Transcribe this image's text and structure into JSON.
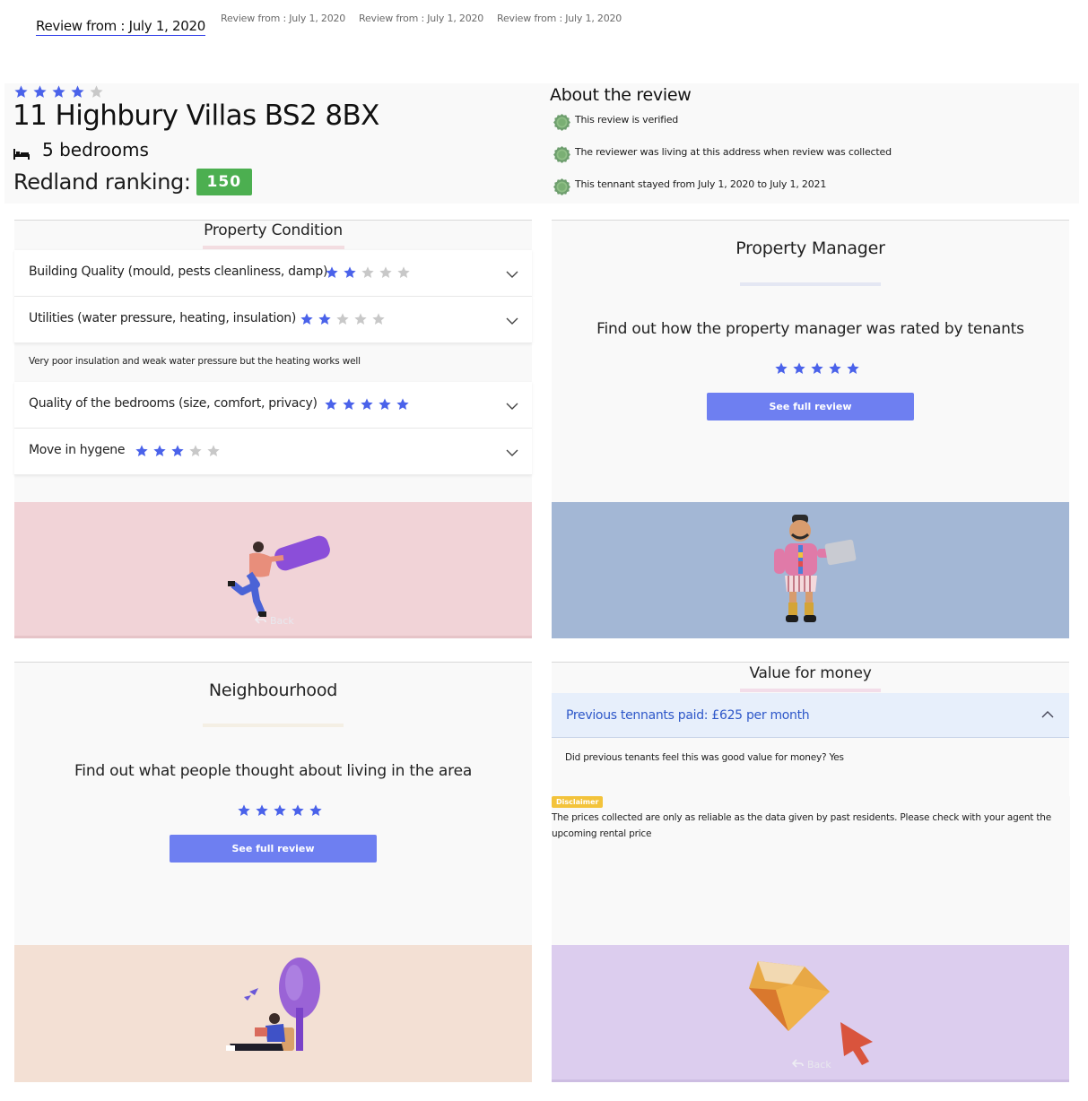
{
  "tabs": [
    {
      "label": "Review from : July 1, 2020",
      "active": true
    },
    {
      "label": "Review from : July 1, 2020",
      "active": false
    },
    {
      "label": "Review from : July 1, 2020",
      "active": false
    },
    {
      "label": "Review from : July 1, 2020",
      "active": false
    }
  ],
  "header": {
    "rating": 4,
    "rating_max": 5,
    "address": "11 Highbury Villas BS2 8BX",
    "bedrooms": "5 bedrooms",
    "ranking_label": "Redland ranking:",
    "ranking_value": "150"
  },
  "about": {
    "title": "About the review",
    "items": [
      "This review is verified",
      "The reviewer was living at this address when review was collected",
      "This tennant stayed from July 1, 2020 to July 1, 2021"
    ]
  },
  "property_condition": {
    "title": "Property Condition",
    "rows": [
      {
        "label": "Building Quality (mould, pests cleanliness, damp)",
        "rating": 2
      },
      {
        "label": "Utilities (water pressure, heating, insulation)",
        "rating": 2
      },
      {
        "label": "Quality of the bedrooms (size, comfort, privacy)",
        "rating": 5
      },
      {
        "label": "Move in hygene",
        "rating": 3
      }
    ],
    "note": "Very poor insulation and weak water pressure but the heating works well",
    "back_label": "Back"
  },
  "property_manager": {
    "title": "Property Manager",
    "text": "Find out how the property manager was rated by tenants",
    "rating": 5,
    "button": "See full review"
  },
  "neighbourhood": {
    "title": "Neighbourhood",
    "text": "Find out what people thought about living in the area",
    "rating": 5,
    "button": "See full review"
  },
  "value_for_money": {
    "title": "Value for money",
    "paid": "Previous tennants paid: £625 per month",
    "question": "Did previous tenants feel this was good value for money? Yes",
    "disclaimer_badge": "Disclaimer",
    "disclaimer_text": "The prices collected are only as reliable as the data given by past residents. Please check with your agent the upcoming rental price",
    "back_label": "Back"
  },
  "colors": {
    "star_on": "#4a62ea",
    "star_off": "#c8c8c8",
    "ranking_badge": "#4caf50",
    "button": "#6e7ff1",
    "condition_bg": "#f1d3d7",
    "manager_bg": "#a3b7d5",
    "neighbourhood_bg": "#f3e0d4",
    "value_bg": "#dccdee"
  }
}
